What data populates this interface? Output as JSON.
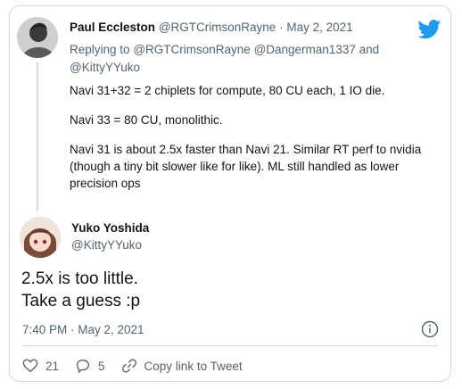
{
  "quoted": {
    "name": "Paul Eccleston",
    "handle": "@RGTCrimsonRayne",
    "separator": "·",
    "date": "May 2, 2021",
    "replying_prefix": "Replying to",
    "replying_users": [
      "@RGTCrimsonRayne",
      "@Dangerman1337",
      "@KittyYYuko"
    ],
    "replying_and": "and",
    "body": [
      "Navi 31+32 = 2 chiplets for compute, 80 CU each, 1 IO die.",
      "Navi 33 = 80 CU, monolithic.",
      "Navi 31 is about 2.5x faster than Navi 21. Similar RT perf to nvidia (though a tiny bit slower like for like). ML still handled as lower precision ops"
    ]
  },
  "main": {
    "name": "Yuko Yoshida",
    "handle": "@KittyYYuko",
    "text_lines": [
      "2.5x is too little.",
      "Take a guess :p"
    ],
    "timestamp": "7:40 PM · May 2, 2021"
  },
  "actions": {
    "likes": "21",
    "replies": "5",
    "copy_link": "Copy link to Tweet"
  },
  "colors": {
    "accent": "#1d9bf0",
    "muted": "#536471",
    "border": "#cfd9de"
  },
  "icons": [
    "twitter-bird-icon",
    "info-icon",
    "heart-icon",
    "reply-icon",
    "link-icon"
  ]
}
